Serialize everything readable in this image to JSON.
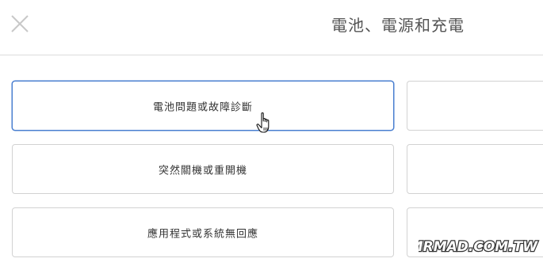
{
  "header": {
    "title": "電池、電源和充電",
    "close_icon": "close-icon"
  },
  "cards": {
    "left": [
      {
        "label": "電池問題或故障診斷",
        "selected": true
      },
      {
        "label": "突然關機或重開機",
        "selected": false
      },
      {
        "label": "應用程式或系統無回應",
        "selected": false
      }
    ],
    "right": [
      {
        "label": ""
      },
      {
        "label": ""
      },
      {
        "label": ""
      }
    ]
  },
  "cursor_icon": "hand-pointer-icon",
  "watermark": {
    "text": "MRMAD.COM.TW",
    "logo_icon": "watermark-logo"
  },
  "colors": {
    "selected_border": "#4a7fd0",
    "card_border": "#d2d2d2",
    "divider": "#dcdcdc",
    "title_text": "#555555",
    "label_text": "#333333",
    "close_icon": "#c8c8c8"
  }
}
